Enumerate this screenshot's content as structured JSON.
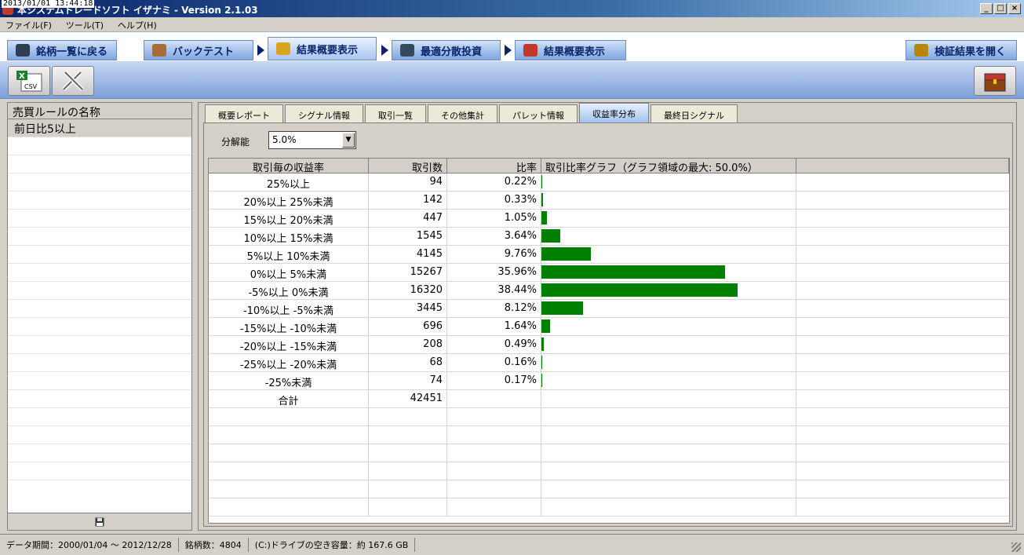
{
  "window": {
    "timestamp": "2013/01/01 13:44:18",
    "title": "本システムトレードソフト イザナミ - Version 2.1.03",
    "buttons": [
      "_",
      "□",
      "×"
    ]
  },
  "menu": {
    "items": [
      "ファイル(F)",
      "ツール(T)",
      "ヘルプ(H)"
    ]
  },
  "nav_tabs": [
    {
      "label": "銘柄一覧に戻る",
      "icon": "eye-icon",
      "color": "#2c3e50"
    },
    {
      "label": "バックテスト",
      "icon": "bag-icon",
      "color": "#a86c3a"
    },
    {
      "label": "結果概要表示",
      "icon": "chart-hand-icon",
      "color": "#d9a520"
    },
    {
      "label": "最適分散投資",
      "icon": "calculator-icon",
      "color": "#34495e"
    },
    {
      "label": "結果概要表示",
      "icon": "bar-chart-icon",
      "color": "#c0392b"
    },
    {
      "label": "検証結果を開く",
      "icon": "open-results-icon",
      "color": "#b8860b"
    }
  ],
  "toolbar": {
    "csv_label": "CSV"
  },
  "left_panel": {
    "header": "売買ルールの名称",
    "rows": [
      "前日比5以上"
    ]
  },
  "sub_tabs": [
    "概要レポート",
    "シグナル情報",
    "取引一覧",
    "その他集計",
    "パレット情報",
    "収益率分布",
    "最終日シグナル"
  ],
  "active_sub_tab": 5,
  "resolution": {
    "label": "分解能",
    "value": "5.0%"
  },
  "table": {
    "headers": [
      "取引毎の収益率",
      "取引数",
      "比率",
      "取引比率グラフ（グラフ領域の最大: 50.0%）"
    ],
    "graph_max_percent": 50.0,
    "bar_color": "#008000"
  },
  "chart_data": {
    "type": "bar",
    "title": "取引比率グラフ（グラフ領域の最大: 50.0%）",
    "categories": [
      "25%以上",
      "20%以上 25%未満",
      "15%以上 20%未満",
      "10%以上 15%未満",
      "5%以上 10%未満",
      "0%以上 5%未満",
      "-5%以上 0%未満",
      "-10%以上 -5%未満",
      "-15%以上 -10%未満",
      "-20%以上 -15%未満",
      "-25%以上 -20%未満",
      "-25%未満"
    ],
    "counts": [
      "94",
      "142",
      "447",
      "1545",
      "4145",
      "15267",
      "16320",
      "3445",
      "696",
      "208",
      "68",
      "74"
    ],
    "ratio_labels": [
      "0.22%",
      "0.33%",
      "1.05%",
      "3.64%",
      "9.76%",
      "35.96%",
      "38.44%",
      "8.12%",
      "1.64%",
      "0.49%",
      "0.16%",
      "0.17%"
    ],
    "values": [
      0.22,
      0.33,
      1.05,
      3.64,
      9.76,
      35.96,
      38.44,
      8.12,
      1.64,
      0.49,
      0.16,
      0.17
    ],
    "xlim": [
      0,
      50
    ]
  },
  "total": {
    "label": "合計",
    "count": "42451"
  },
  "status": {
    "period": "データ期間：2000/01/04 〜 2012/12/28",
    "symbols": "銘柄数：4804",
    "disk": "(C:)ドライブの空き容量：約 167.6 GB"
  }
}
